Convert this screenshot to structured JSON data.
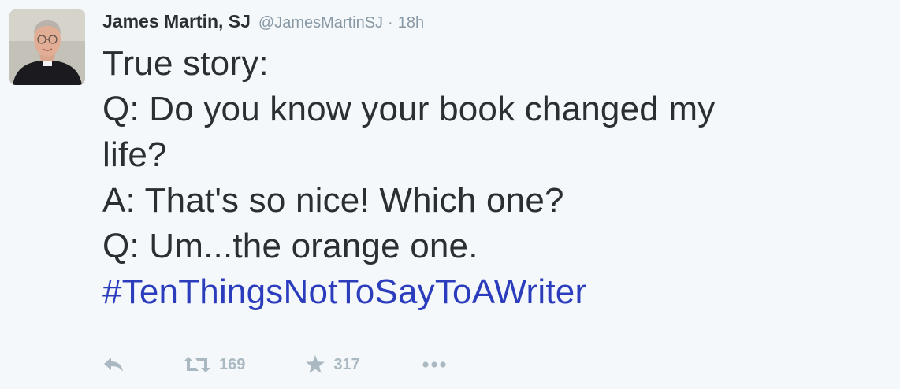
{
  "tweet": {
    "author": {
      "fullname": "James Martin, SJ",
      "username": "@JamesMartinSJ",
      "separator": "·",
      "time": "18h"
    },
    "lines": [
      "True story:",
      "Q: Do you know your book changed my",
      "life?",
      "A: That's so nice! Which one?",
      "Q: Um...the orange one."
    ],
    "hashtag": "#TenThingsNotToSayToAWriter",
    "actions": {
      "retweet_count": "169",
      "favorite_count": "317"
    },
    "icons": [
      "reply-icon",
      "retweet-icon",
      "favorite-icon",
      "more-icon"
    ],
    "colors": {
      "background": "#f5f8fa",
      "text": "#292f33",
      "muted": "#8899a6",
      "hashtag": "#2b3dbd",
      "action_icon": "#aab8c2"
    }
  }
}
